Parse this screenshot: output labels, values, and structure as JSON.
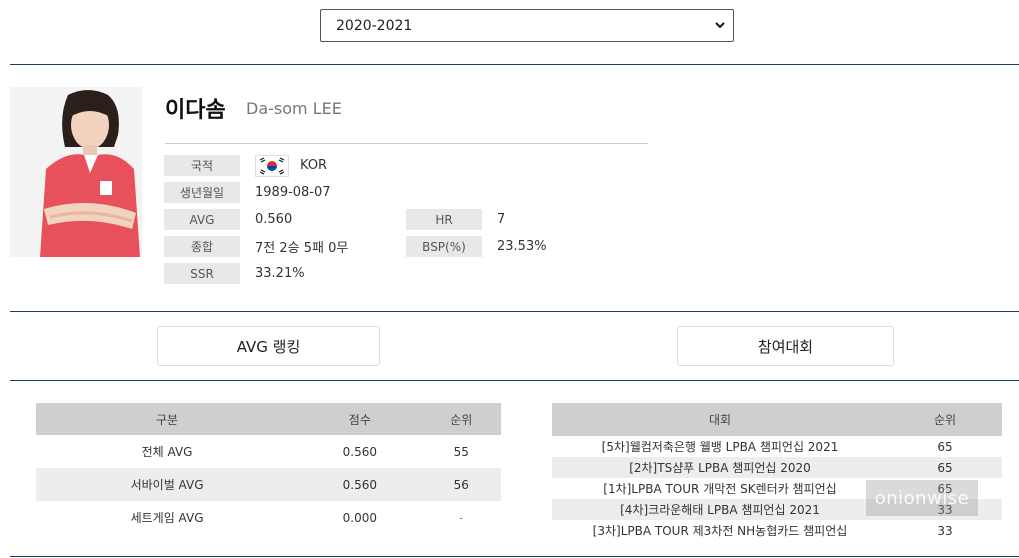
{
  "season_select": {
    "value": "2020-2021"
  },
  "profile": {
    "name_ko": "이다솜",
    "name_en": "Da-som LEE",
    "fields": {
      "nationality_label": "국적",
      "nationality_value": "KOR",
      "birth_label": "생년월일",
      "birth_value": "1989-08-07",
      "avg_label": "AVG",
      "avg_value": "0.560",
      "hr_label": "HR",
      "hr_value": "7",
      "record_label": "종합",
      "record_value": "7전 2승 5패 0무",
      "bsp_label": "BSP(%)",
      "bsp_value": "23.53%",
      "ssr_label": "SSR",
      "ssr_value": "33.21%"
    }
  },
  "tabs": {
    "avg_ranking": "AVG 랭킹",
    "tournaments": "참여대회"
  },
  "avg_table": {
    "headers": [
      "구분",
      "점수",
      "순위"
    ],
    "rows": [
      [
        "전체 AVG",
        "0.560",
        "55"
      ],
      [
        "서바이벌 AVG",
        "0.560",
        "56"
      ],
      [
        "세트게임 AVG",
        "0.000",
        "-"
      ]
    ]
  },
  "tour_table": {
    "headers": [
      "대회",
      "순위"
    ],
    "rows": [
      [
        "[5차]웰컴저축은행 웰뱅 LPBA 챔피언십 2021",
        "65"
      ],
      [
        "[2차]TS샴푸 LPBA 챔피언십 2020",
        "65"
      ],
      [
        "[1차]LPBA TOUR 개막전 SK렌터카 챔피언십",
        "65"
      ],
      [
        "[4차]크라운해태 LPBA 챔피언십 2021",
        "33"
      ],
      [
        "[3차]LPBA TOUR 제3차전 NH농협카드 챔피언십",
        "33"
      ]
    ]
  },
  "watermark": "onionwise",
  "colors": {
    "divider": "#1f3f5e",
    "header_bg": "#cfcfcf",
    "label_bg": "#e8e8e8",
    "jersey": "#e8505b"
  },
  "icons": [
    "chevron-down-icon",
    "korea-flag-icon"
  ]
}
